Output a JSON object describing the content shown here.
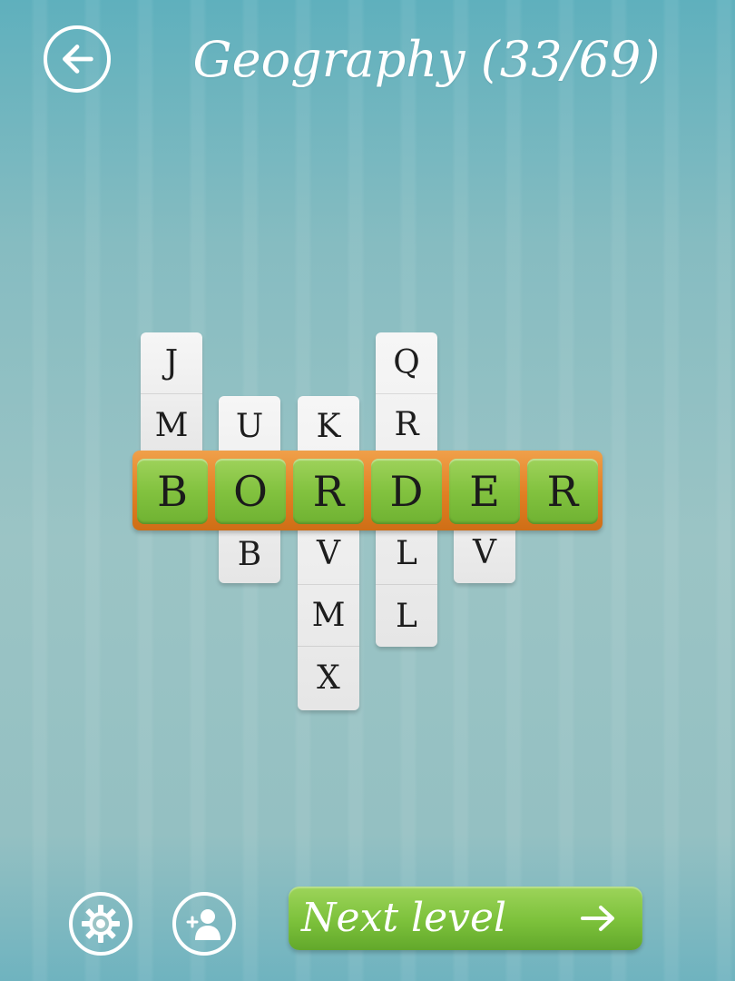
{
  "header": {
    "title": "Geography (33/69)",
    "back_icon": "arrow-left-circle-icon"
  },
  "board": {
    "columns": [
      {
        "letters_above": [
          "J",
          "M"
        ],
        "letters_below": []
      },
      {
        "letters_above": [
          "U"
        ],
        "letters_below": [
          "B"
        ]
      },
      {
        "letters_above": [
          "K"
        ],
        "letters_below": [
          "V",
          "M",
          "X"
        ]
      },
      {
        "letters_above": [
          "Q",
          "R"
        ],
        "letters_below": [
          "L",
          "L"
        ]
      },
      {
        "letters_above": [],
        "letters_below": [
          "V"
        ]
      },
      {
        "letters_above": [],
        "letters_below": []
      }
    ],
    "word": [
      "B",
      "O",
      "R",
      "D",
      "E",
      "R"
    ]
  },
  "footer": {
    "settings_icon": "gear-icon",
    "friends_icon": "add-user-icon",
    "next_label": "Next level",
    "next_icon": "arrow-right-icon"
  },
  "colors": {
    "word_tile": "#82c23f",
    "word_bar": "#e07f23",
    "next_button": "#7cc13b"
  }
}
